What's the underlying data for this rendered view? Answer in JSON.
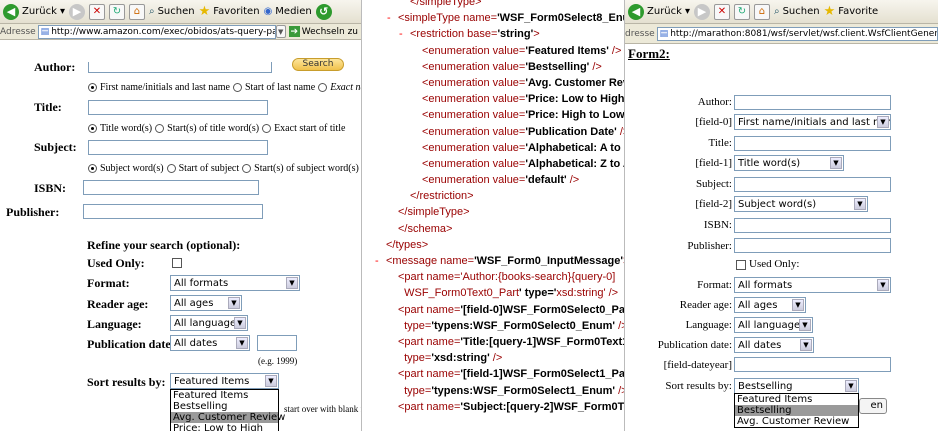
{
  "left": {
    "toolbar": {
      "back": "Zurück",
      "search": "Suchen",
      "favorites": "Favoriten",
      "media": "Medien"
    },
    "address": {
      "label": "Adresse",
      "url": "http://www.amazon.com/exec/obidos/ats-query-page/ref=b_bh_l_a_",
      "go": "Wechseln zu"
    },
    "search_now": "Search Now",
    "author_label": "Author:",
    "author_radios": [
      "First name/initials and last name",
      "Start of last name",
      "Exact name"
    ],
    "title_label": "Title:",
    "title_radios": [
      "Title word(s)",
      "Start(s) of title word(s)",
      "Exact start of title"
    ],
    "subject_label": "Subject:",
    "subject_radios": [
      "Subject word(s)",
      "Start of subject",
      "Start(s) of subject word(s)"
    ],
    "isbn_label": "ISBN:",
    "publisher_label": "Publisher:",
    "refine": "Refine your search (optional):",
    "used_only": "Used Only:",
    "format_label": "Format:",
    "format_value": "All formats",
    "reader_age_label": "Reader age:",
    "reader_age_value": "All ages",
    "language_label": "Language:",
    "language_value": "All languages",
    "pubdate_label": "Publication date:",
    "pubdate_value": "All dates",
    "eg": "(e.g. 1999)",
    "sort_label": "Sort results by:",
    "sort_value": "Featured Items",
    "sort_options": [
      "Featured Items",
      "Bestselling",
      "Avg. Customer Review",
      "Price: Low to High"
    ],
    "start_over": "start over with blank fie"
  },
  "xml": {
    "lines": [
      {
        "indent": 1,
        "html": "</simpleType>"
      },
      {
        "indent": 0,
        "minus": true,
        "html": "<simpleType name='WSF_Form0Select8_Enum'>"
      },
      {
        "indent": 1,
        "minus": true,
        "html": "<restriction base='string'>"
      },
      {
        "indent": 2,
        "html": "<enumeration value='Featured Items' />"
      },
      {
        "indent": 2,
        "html": "<enumeration value='Bestselling' />"
      },
      {
        "indent": 2,
        "html": "<enumeration value='Avg. Customer Review' />"
      },
      {
        "indent": 2,
        "html": "<enumeration value='Price: Low to High' />"
      },
      {
        "indent": 2,
        "html": "<enumeration value='Price: High to Low' />"
      },
      {
        "indent": 2,
        "html": "<enumeration value='Publication Date' />"
      },
      {
        "indent": 2,
        "html": "<enumeration value='Alphabetical: A to Z' />"
      },
      {
        "indent": 2,
        "html": "<enumeration value='Alphabetical: Z to A' />"
      },
      {
        "indent": 2,
        "html": "<enumeration value='default' />"
      },
      {
        "indent": 1,
        "html": "</restriction>"
      },
      {
        "indent": 0,
        "html": "</simpleType>"
      },
      {
        "indent": 0,
        "html": "</schema>"
      },
      {
        "indent": -1,
        "html": "</types>"
      },
      {
        "indent": -1,
        "minus": true,
        "html": "<message name='WSF_Form0_InputMessage'>"
      },
      {
        "indent": 0,
        "html": "<part name='Author:{books-search}{query-0]"
      },
      {
        "indent": 0,
        "html": "  WSF_Form0Text0_Part' type='xsd:string' />"
      },
      {
        "indent": 0,
        "html": "<part name='[field-0]WSF_Form0Select0_Part'"
      },
      {
        "indent": 0,
        "html": "  type='typens:WSF_Form0Select0_Enum' />"
      },
      {
        "indent": 0,
        "html": "<part name='Title:[query-1]WSF_Form0Text1_Part'"
      },
      {
        "indent": 0,
        "html": "  type='xsd:string' />"
      },
      {
        "indent": 0,
        "html": "<part name='[field-1]WSF_Form0Select1_Part'"
      },
      {
        "indent": 0,
        "html": "  type='typens:WSF_Form0Select1_Enum' />"
      },
      {
        "indent": 0,
        "html": "<part name='Subject:[query-2]WSF_Form0Text2_Part'"
      }
    ]
  },
  "right": {
    "toolbar": {
      "back": "Zurück",
      "search": "Suchen",
      "favorites": "Favorite"
    },
    "address": {
      "label": "dresse",
      "url": "http://marathon:8081/wsf/servlet/wsf.client.WsfClientGenerate"
    },
    "form_title": "Form2:",
    "author": "Author:",
    "field0": "[field-0]",
    "field0_value": "First name/initials and last name",
    "title": "Title:",
    "field1": "[field-1]",
    "field1_value": "Title word(s)",
    "subject": "Subject:",
    "field2": "[field-2]",
    "field2_value": "Subject word(s)",
    "isbn": "ISBN:",
    "publisher": "Publisher:",
    "used_only": "Used Only:",
    "format": "Format:",
    "format_value": "All formats",
    "reader_age": "Reader age:",
    "reader_age_value": "All ages",
    "language": "Language:",
    "language_value": "All languages",
    "pubdate": "Publication date:",
    "pubdate_value": "All dates",
    "dateyear": "[field-dateyear]",
    "sort": "Sort results by:",
    "sort_value": "Bestselling",
    "sort_options": [
      "Featured Items",
      "Bestselling",
      "Avg. Customer Review"
    ],
    "btn_partial": "en"
  }
}
